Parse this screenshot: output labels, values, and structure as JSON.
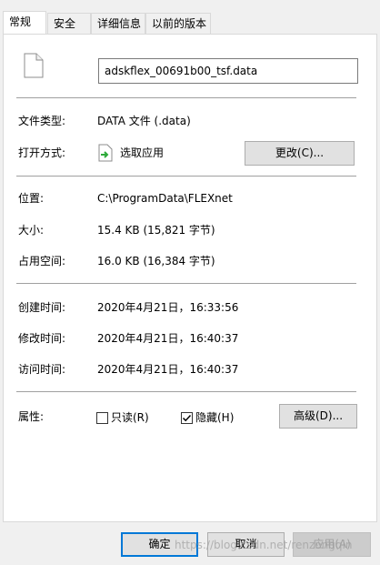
{
  "tabs": [
    "常规",
    "安全",
    "详细信息",
    "以前的版本"
  ],
  "file": {
    "name": "adskflex_00691b00_tsf.data",
    "icon": "blank-file-icon"
  },
  "rows": {
    "type": {
      "label": "文件类型:",
      "value": "DATA 文件 (.data)"
    },
    "open_with": {
      "label": "打开方式:",
      "value": "选取应用",
      "icon": "select-app-icon",
      "button": "更改(C)..."
    },
    "location": {
      "label": "位置:",
      "value": "C:\\ProgramData\\FLEXnet"
    },
    "size": {
      "label": "大小:",
      "value": "15.4 KB (15,821 字节)"
    },
    "size_on_disk": {
      "label": "占用空间:",
      "value": "16.0 KB (16,384 字节)"
    },
    "created": {
      "label": "创建时间:",
      "value": "2020年4月21日，16:33:56"
    },
    "modified": {
      "label": "修改时间:",
      "value": "2020年4月21日，16:40:37"
    },
    "accessed": {
      "label": "访问时间:",
      "value": "2020年4月21日，16:40:37"
    },
    "attributes": {
      "label": "属性:",
      "readonly": {
        "label": "只读(R)",
        "checked": false
      },
      "hidden": {
        "label": "隐藏(H)",
        "checked": true
      },
      "advanced_button": "高级(D)..."
    }
  },
  "footer": {
    "ok": "确定",
    "cancel": "取消",
    "apply": "应用(A)"
  },
  "watermark": "https://blog.csdn.net/renzongqin",
  "colors": {
    "accent": "#0078d7",
    "green_arrow": "#2eaa3a"
  }
}
